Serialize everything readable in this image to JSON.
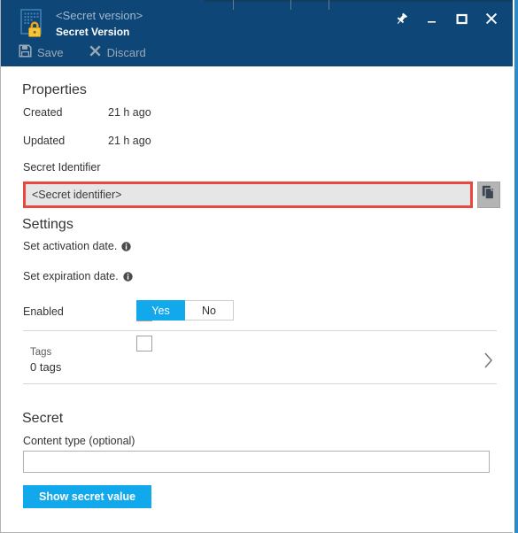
{
  "window": {
    "title_main": "<Secret version>",
    "title_sub": "Secret Version",
    "icon": "secret-lock-icon",
    "controls": [
      {
        "name": "pin",
        "label": "Pin"
      },
      {
        "name": "minimize",
        "label": "Minimize"
      },
      {
        "name": "maximize",
        "label": "Maximize"
      },
      {
        "name": "close",
        "label": "Close"
      }
    ]
  },
  "commandbar": {
    "save_label": "Save",
    "discard_label": "Discard"
  },
  "properties": {
    "heading": "Properties",
    "rows": [
      {
        "key": "Created",
        "value": "21 h ago"
      },
      {
        "key": "Updated",
        "value": "21 h ago"
      }
    ],
    "secret_identifier_label": "Secret Identifier",
    "secret_identifier_value": "<Secret identifier>",
    "copy_button_title": "Copy to clipboard"
  },
  "settings": {
    "heading": "Settings",
    "activation_label": "Set activation date.",
    "activation_checked": false,
    "expiration_label": "Set expiration date.",
    "expiration_checked": false,
    "enabled_label": "Enabled",
    "enabled_options": [
      "Yes",
      "No"
    ],
    "enabled_selected": "Yes"
  },
  "tags": {
    "title": "Tags",
    "count_label": "0 tags"
  },
  "secret": {
    "heading": "Secret",
    "content_type_label": "Content type (optional)",
    "content_type_value": "",
    "content_type_placeholder": "",
    "show_secret_button": "Show secret value"
  },
  "colors": {
    "header_blue": "#0e4777",
    "accent_blue": "#12a9ec",
    "highlight_red": "#e8483f",
    "blade_edge": "#2c8ac9"
  }
}
